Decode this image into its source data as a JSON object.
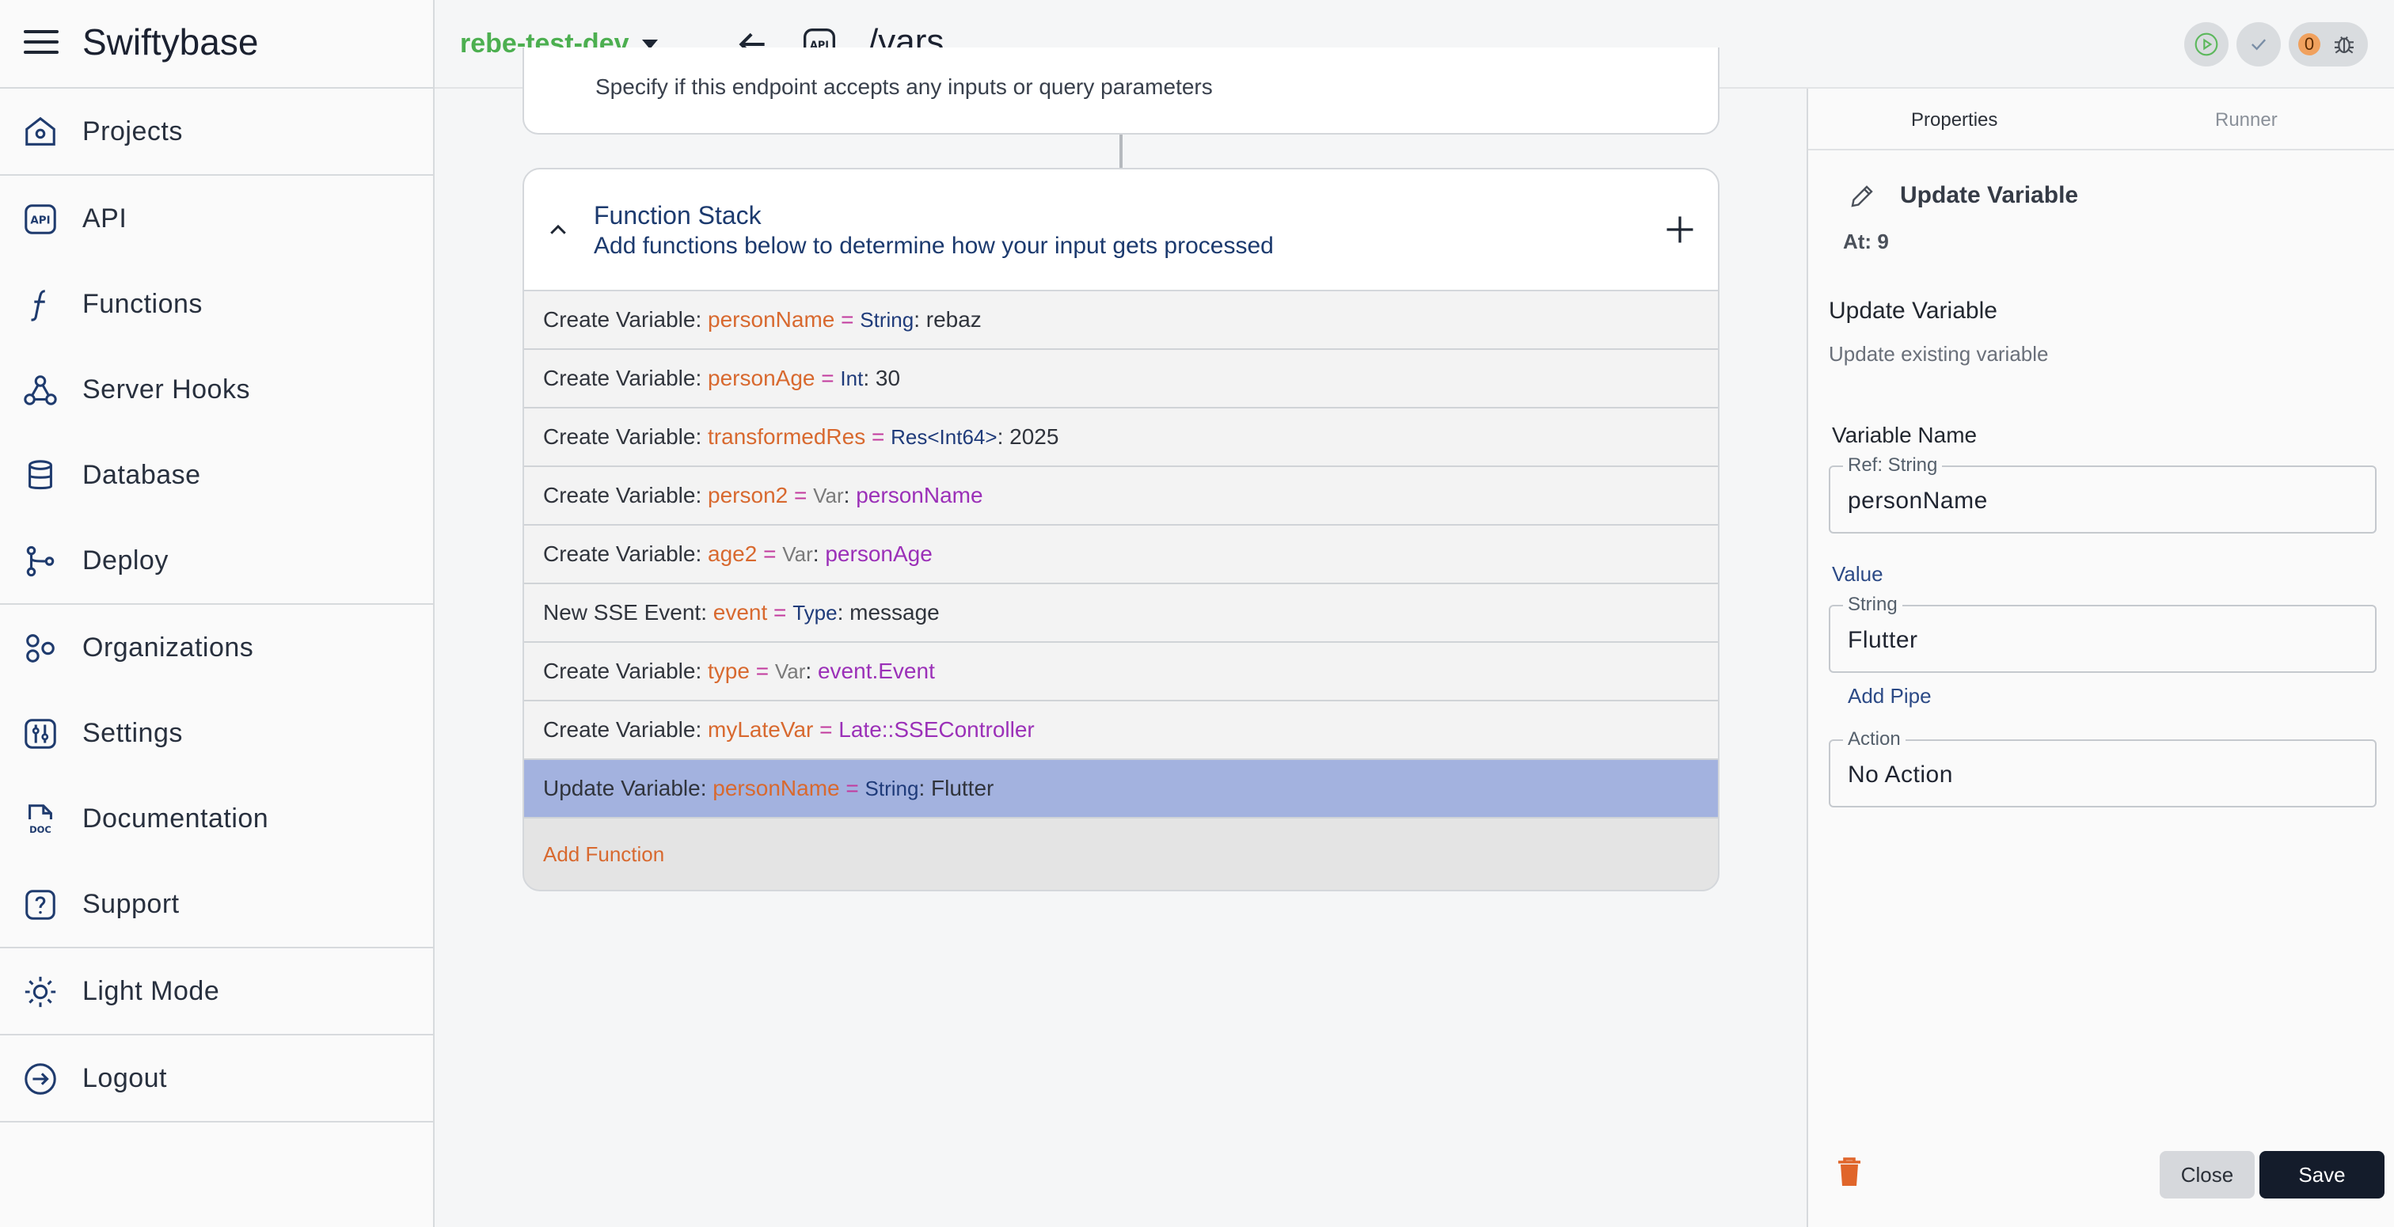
{
  "app": {
    "title": "Swiftybase"
  },
  "sidebar": {
    "items": [
      {
        "label": "Projects",
        "icon": "home-icon"
      },
      {
        "label": "API",
        "icon": "api-icon"
      },
      {
        "label": "Functions",
        "icon": "function-icon"
      },
      {
        "label": "Server Hooks",
        "icon": "webhook-icon"
      },
      {
        "label": "Database",
        "icon": "database-icon"
      },
      {
        "label": "Deploy",
        "icon": "git-branch-icon"
      },
      {
        "label": "Organizations",
        "icon": "organization-icon"
      },
      {
        "label": "Settings",
        "icon": "settings-icon"
      },
      {
        "label": "Documentation",
        "icon": "document-icon"
      },
      {
        "label": "Support",
        "icon": "help-icon"
      },
      {
        "label": "Light Mode",
        "icon": "sun-icon"
      },
      {
        "label": "Logout",
        "icon": "logout-icon"
      }
    ]
  },
  "topbar": {
    "environment": "rebe-test-dev",
    "api_badge": "API",
    "path": "/vars",
    "error_count": "0"
  },
  "endpoint_card": {
    "text": "Specify if this endpoint accepts any inputs or query parameters"
  },
  "function_stack": {
    "title": "Function Stack",
    "subtitle": "Add functions below to determine how your input gets processed",
    "add_label": "Add Function",
    "rows": [
      {
        "prefix": "Create Variable: ",
        "var": "personName",
        "eq": " = ",
        "type": "String",
        "sep": ": ",
        "value": "rebaz",
        "kind": "literal"
      },
      {
        "prefix": "Create Variable: ",
        "var": "personAge",
        "eq": " = ",
        "type": "Int",
        "sep": ": ",
        "value": "30",
        "kind": "literal"
      },
      {
        "prefix": "Create Variable: ",
        "var": "transformedRes",
        "eq": " = ",
        "type": "Res<Int64>",
        "sep": ": ",
        "value": "2025",
        "kind": "literal"
      },
      {
        "prefix": "Create Variable: ",
        "var": "person2",
        "eq": " = ",
        "type": "Var",
        "sep": ": ",
        "value": "personName",
        "kind": "ref"
      },
      {
        "prefix": "Create Variable: ",
        "var": "age2",
        "eq": " = ",
        "type": "Var",
        "sep": ": ",
        "value": "personAge",
        "kind": "ref"
      },
      {
        "prefix": "New SSE Event: ",
        "var": "event",
        "eq": " = ",
        "type": "Type",
        "sep": ": ",
        "value": "message",
        "kind": "literal-gray"
      },
      {
        "prefix": "Create Variable: ",
        "var": "type",
        "eq": " = ",
        "type": "Var",
        "sep": ": ",
        "value": "event.Event",
        "kind": "ref"
      },
      {
        "prefix": "Create Variable: ",
        "var": "myLateVar",
        "eq": " = ",
        "type": "Late::SSEController",
        "sep": "",
        "value": "",
        "kind": "late"
      },
      {
        "prefix": "Update Variable: ",
        "var": "personName",
        "eq": " = ",
        "type": "String",
        "sep": ": ",
        "value": "Flutter",
        "kind": "literal",
        "selected": true
      }
    ]
  },
  "panel": {
    "tabs": [
      "Properties",
      "Runner"
    ],
    "title": "Update Variable",
    "at": "At: 9",
    "heading": "Update Variable",
    "description": "Update existing variable",
    "variable_name_label": "Variable Name",
    "variable_legend": "Ref: String",
    "variable_value": "personName",
    "value_label": "Value",
    "value_legend": "String",
    "value_value": "Flutter",
    "add_pipe": "Add Pipe",
    "action_legend": "Action",
    "action_value": "No Action",
    "close": "Close",
    "save": "Save"
  }
}
